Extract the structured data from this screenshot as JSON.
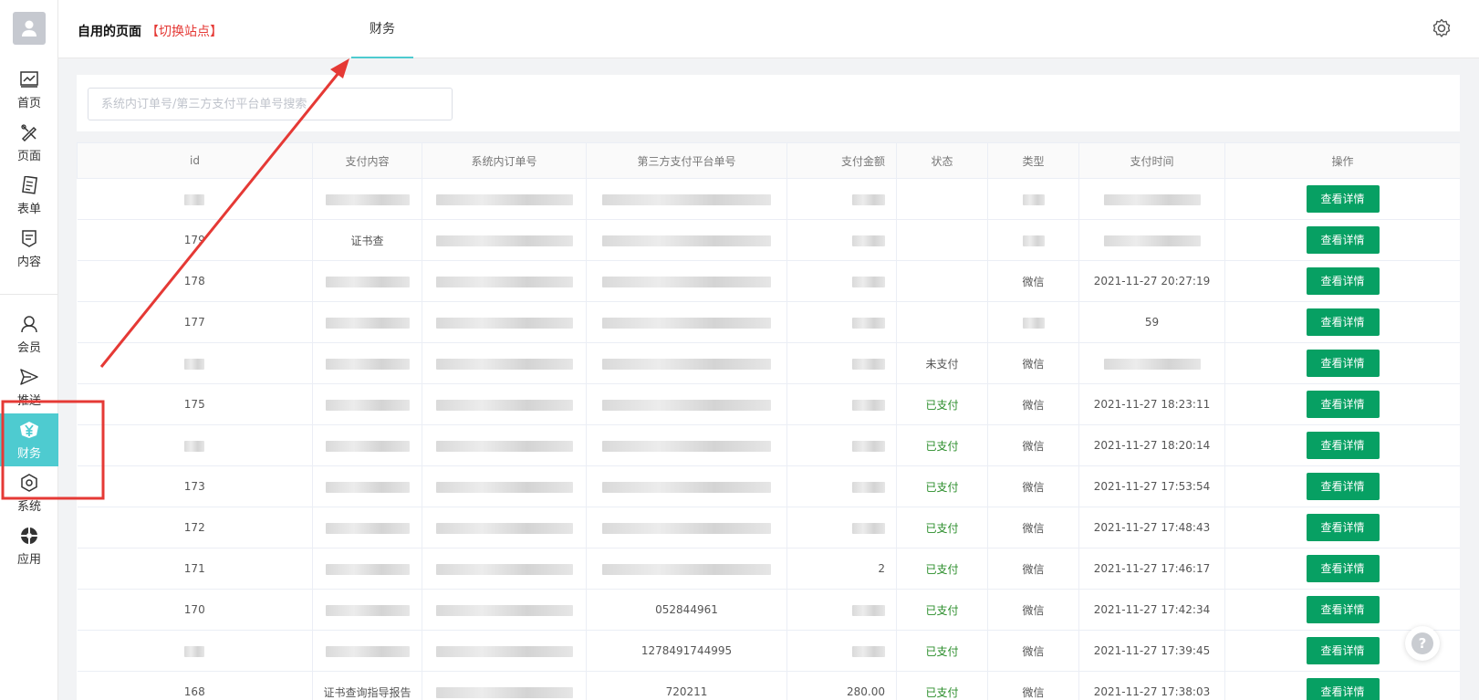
{
  "header": {
    "site_title": "自用的页面",
    "switch_link": "【切换站点】",
    "active_tab": "财务"
  },
  "sidebar": {
    "items": [
      {
        "label": "首页",
        "icon": "chart-icon"
      },
      {
        "label": "页面",
        "icon": "design-icon"
      },
      {
        "label": "表单",
        "icon": "form-icon"
      },
      {
        "label": "内容",
        "icon": "content-icon"
      },
      {
        "label": "会员",
        "icon": "user-icon"
      },
      {
        "label": "推送",
        "icon": "send-icon"
      },
      {
        "label": "财务",
        "icon": "yen-icon",
        "active": true
      },
      {
        "label": "系统",
        "icon": "system-icon"
      },
      {
        "label": "应用",
        "icon": "app-icon"
      }
    ]
  },
  "search": {
    "placeholder": "系统内订单号/第三方支付平台单号搜索"
  },
  "table": {
    "columns": [
      "id",
      "支付内容",
      "系统内订单号",
      "第三方支付平台单号",
      "支付金额",
      "状态",
      "类型",
      "支付时间",
      "操作"
    ],
    "action_label": "查看详情",
    "rows": [
      {
        "id": "",
        "content": "",
        "order": "",
        "third": "",
        "amount": "",
        "status": "",
        "type": "",
        "time": ""
      },
      {
        "id": "179",
        "content": "证书查",
        "order": "",
        "third": "",
        "amount": "",
        "status": "",
        "type": "",
        "time": ""
      },
      {
        "id": "178",
        "content": "",
        "order": "",
        "third": "",
        "amount": "",
        "status": "",
        "type": "微信",
        "time": "2021-11-27 20:27:19"
      },
      {
        "id": "177",
        "content": "",
        "order": "",
        "third": "",
        "amount": "",
        "status": "",
        "type": "",
        "time": "59"
      },
      {
        "id": "",
        "content": "",
        "order": "",
        "third": "",
        "amount": "",
        "status": "未支付",
        "type": "微信",
        "time": ""
      },
      {
        "id": "175",
        "content": "",
        "order": "",
        "third": "",
        "amount": "",
        "status": "已支付",
        "type": "微信",
        "time": "2021-11-27 18:23:11"
      },
      {
        "id": "",
        "content": "",
        "order": "",
        "third": "",
        "amount": "",
        "status": "已支付",
        "type": "微信",
        "time": "2021-11-27 18:20:14"
      },
      {
        "id": "173",
        "content": "",
        "order": "",
        "third": "",
        "amount": "",
        "status": "已支付",
        "type": "微信",
        "time": "2021-11-27 17:53:54"
      },
      {
        "id": "172",
        "content": "",
        "order": "",
        "third": "",
        "amount": "",
        "status": "已支付",
        "type": "微信",
        "time": "2021-11-27 17:48:43"
      },
      {
        "id": "171",
        "content": "",
        "order": "",
        "third": "",
        "amount": "2",
        "status": "已支付",
        "type": "微信",
        "time": "2021-11-27 17:46:17"
      },
      {
        "id": "170",
        "content": "",
        "order": "",
        "third": "052844961",
        "amount": "",
        "status": "已支付",
        "type": "微信",
        "time": "2021-11-27 17:42:34"
      },
      {
        "id": "",
        "content": "",
        "order": "",
        "third": "1278491744995",
        "amount": "",
        "status": "已支付",
        "type": "微信",
        "time": "2021-11-27 17:39:45"
      },
      {
        "id": "168",
        "content": "证书查询指导报告",
        "order": "",
        "third": "720211",
        "amount": "280.00",
        "status": "已支付",
        "type": "微信",
        "time": "2021-11-27 17:38:03"
      }
    ]
  },
  "help_label": "?",
  "colors": {
    "accent": "#4ecbd0",
    "button": "#07a063",
    "paid": "#2a8d2a",
    "annotation": "#e53935"
  }
}
